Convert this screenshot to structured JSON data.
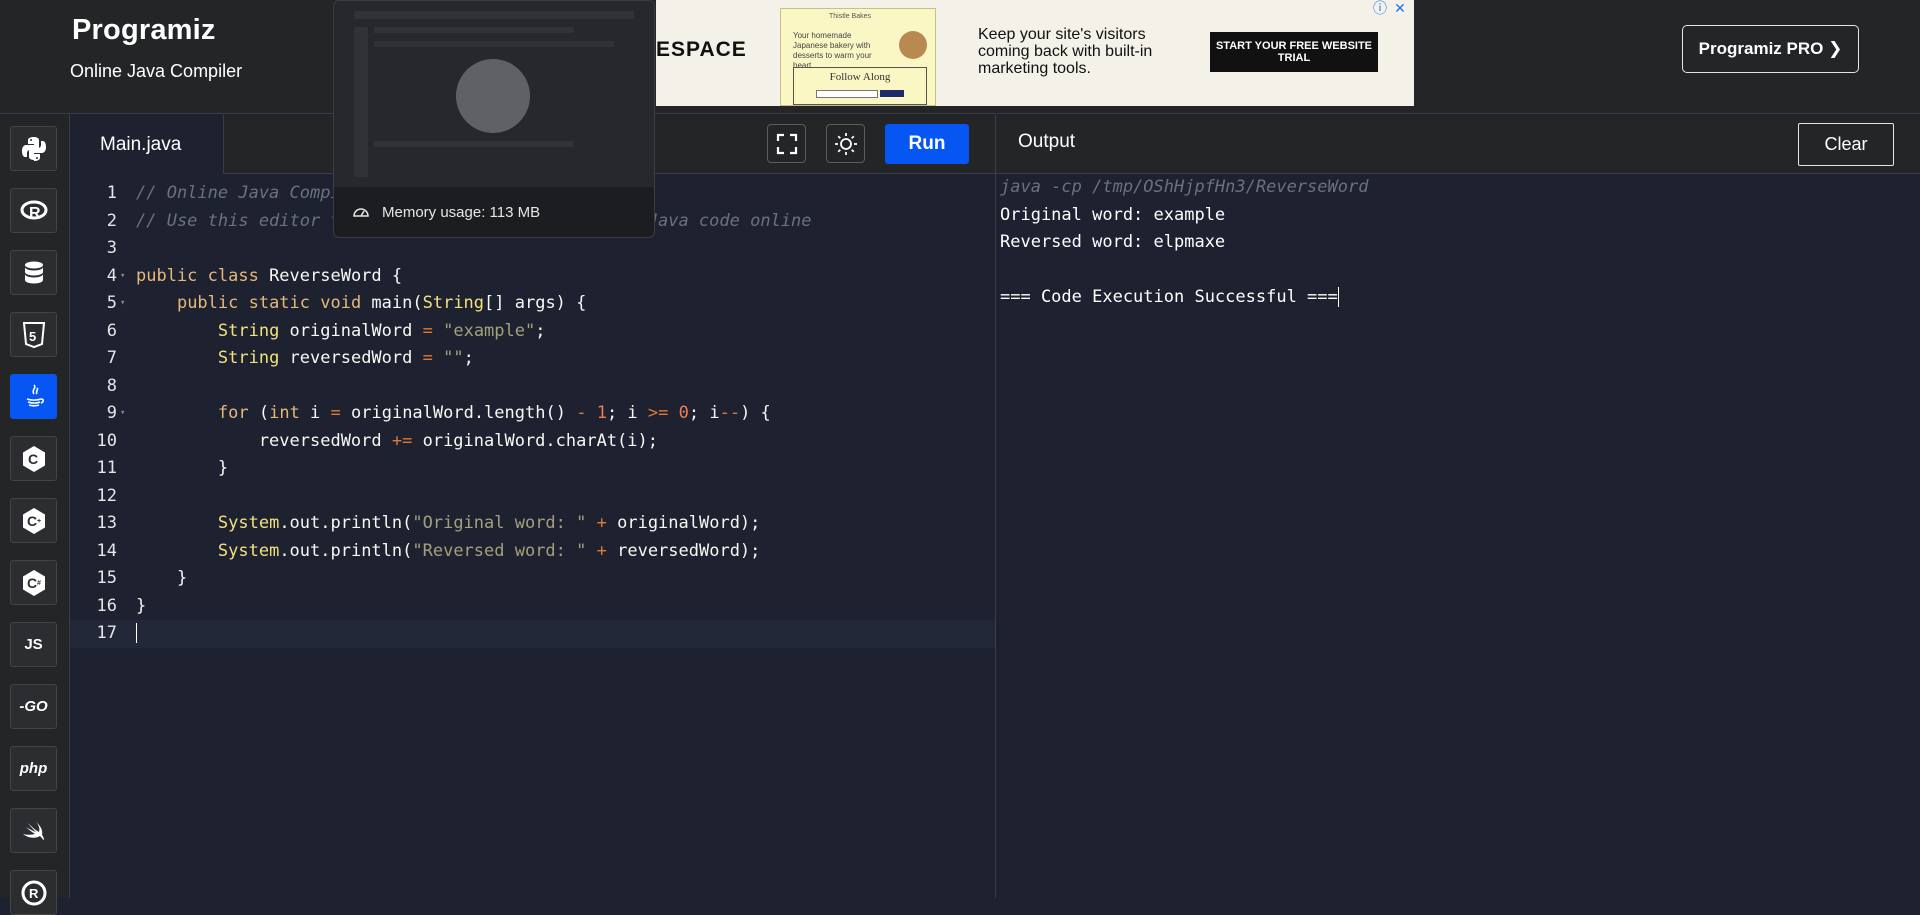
{
  "header": {
    "logo_text": "Programiz",
    "subtitle": "Online Java Compiler",
    "pro_button": "Programiz PRO ❯"
  },
  "ad": {
    "left_text": "ESPACE",
    "card_brand": "Thistle Bakes",
    "card_line": "Your homemade Japanese bakery with desserts to warm your heart.",
    "card_follow": "Follow Along",
    "headline": "Keep your site's visitors coming back with built-in marketing tools.",
    "cta": "START YOUR FREE WEBSITE TRIAL"
  },
  "sidebar": {
    "items": [
      {
        "name": "python",
        "label": ""
      },
      {
        "name": "r",
        "label": "R"
      },
      {
        "name": "sql",
        "label": ""
      },
      {
        "name": "html",
        "label": "5"
      },
      {
        "name": "java",
        "label": ""
      },
      {
        "name": "c",
        "label": "C"
      },
      {
        "name": "cpp",
        "label": "C"
      },
      {
        "name": "csharp",
        "label": "C"
      },
      {
        "name": "javascript",
        "label": "JS"
      },
      {
        "name": "go",
        "label": "-GO"
      },
      {
        "name": "php",
        "label": "php"
      },
      {
        "name": "swift",
        "label": ""
      },
      {
        "name": "rust",
        "label": "R"
      }
    ],
    "active": "java"
  },
  "editor": {
    "tab": "Main.java",
    "run_label": "Run",
    "line_numbers": [
      "1",
      "2",
      "3",
      "4",
      "5",
      "6",
      "7",
      "8",
      "9",
      "10",
      "11",
      "12",
      "13",
      "14",
      "15",
      "16",
      "17"
    ],
    "folds": [
      "",
      "",
      "",
      "▾",
      "▾",
      "",
      "",
      "",
      "▾",
      "",
      "",
      "",
      "",
      "",
      "",
      "",
      ""
    ]
  },
  "memory_popup": {
    "label": "Memory usage: 113 MB"
  },
  "output": {
    "title": "Output",
    "clear_label": "Clear",
    "command": "java -cp /tmp/OShHjpfHn3/ReverseWord",
    "line1": "Original word: example",
    "line2": "Reversed word: elpmaxe",
    "status": "=== Code Execution Successful ==="
  }
}
